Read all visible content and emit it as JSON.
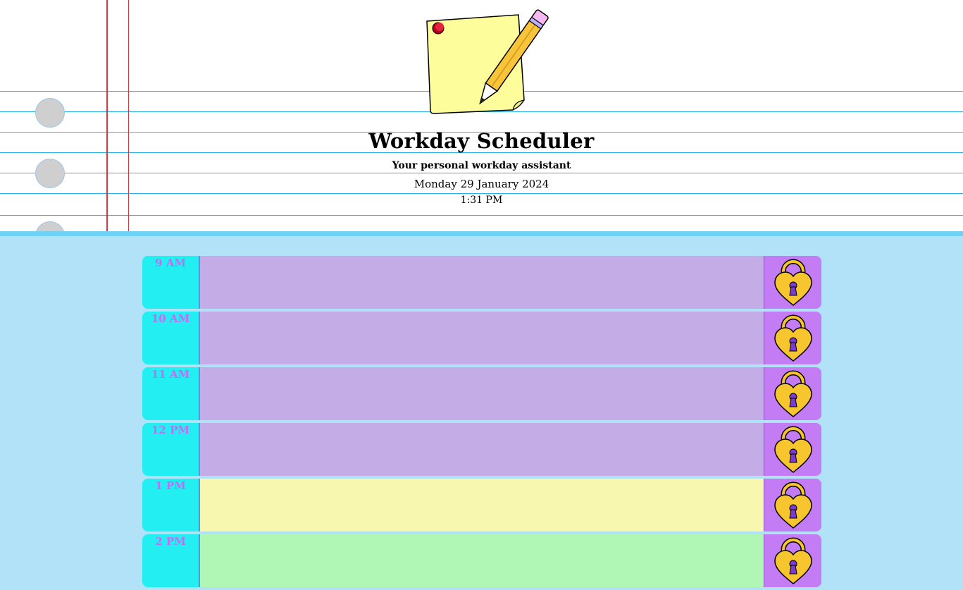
{
  "header": {
    "title": "Workday Scheduler",
    "subtitle": "Your personal workday assistant",
    "date": "Monday 29 January 2024",
    "time": "1:31 PM"
  },
  "schedule": {
    "rows": [
      {
        "hour": "9 AM",
        "text": "",
        "state": "past"
      },
      {
        "hour": "10 AM",
        "text": "",
        "state": "past"
      },
      {
        "hour": "11 AM",
        "text": "",
        "state": "past"
      },
      {
        "hour": "12 PM",
        "text": "",
        "state": "past"
      },
      {
        "hour": "1 PM",
        "text": "",
        "state": "present"
      },
      {
        "hour": "2 PM",
        "text": "",
        "state": "future"
      }
    ]
  },
  "icons": {
    "logo": "sticky-note-pencil-icon",
    "save": "heart-lock-icon"
  },
  "colors": {
    "hour_bg": "#23eff2",
    "hour_text": "#c56df2",
    "past": "#c4ade6",
    "present": "#f8f7b0",
    "future": "#b0f7b5",
    "save_bg": "#c47cf5",
    "page_bg": "#b1e2f8"
  }
}
